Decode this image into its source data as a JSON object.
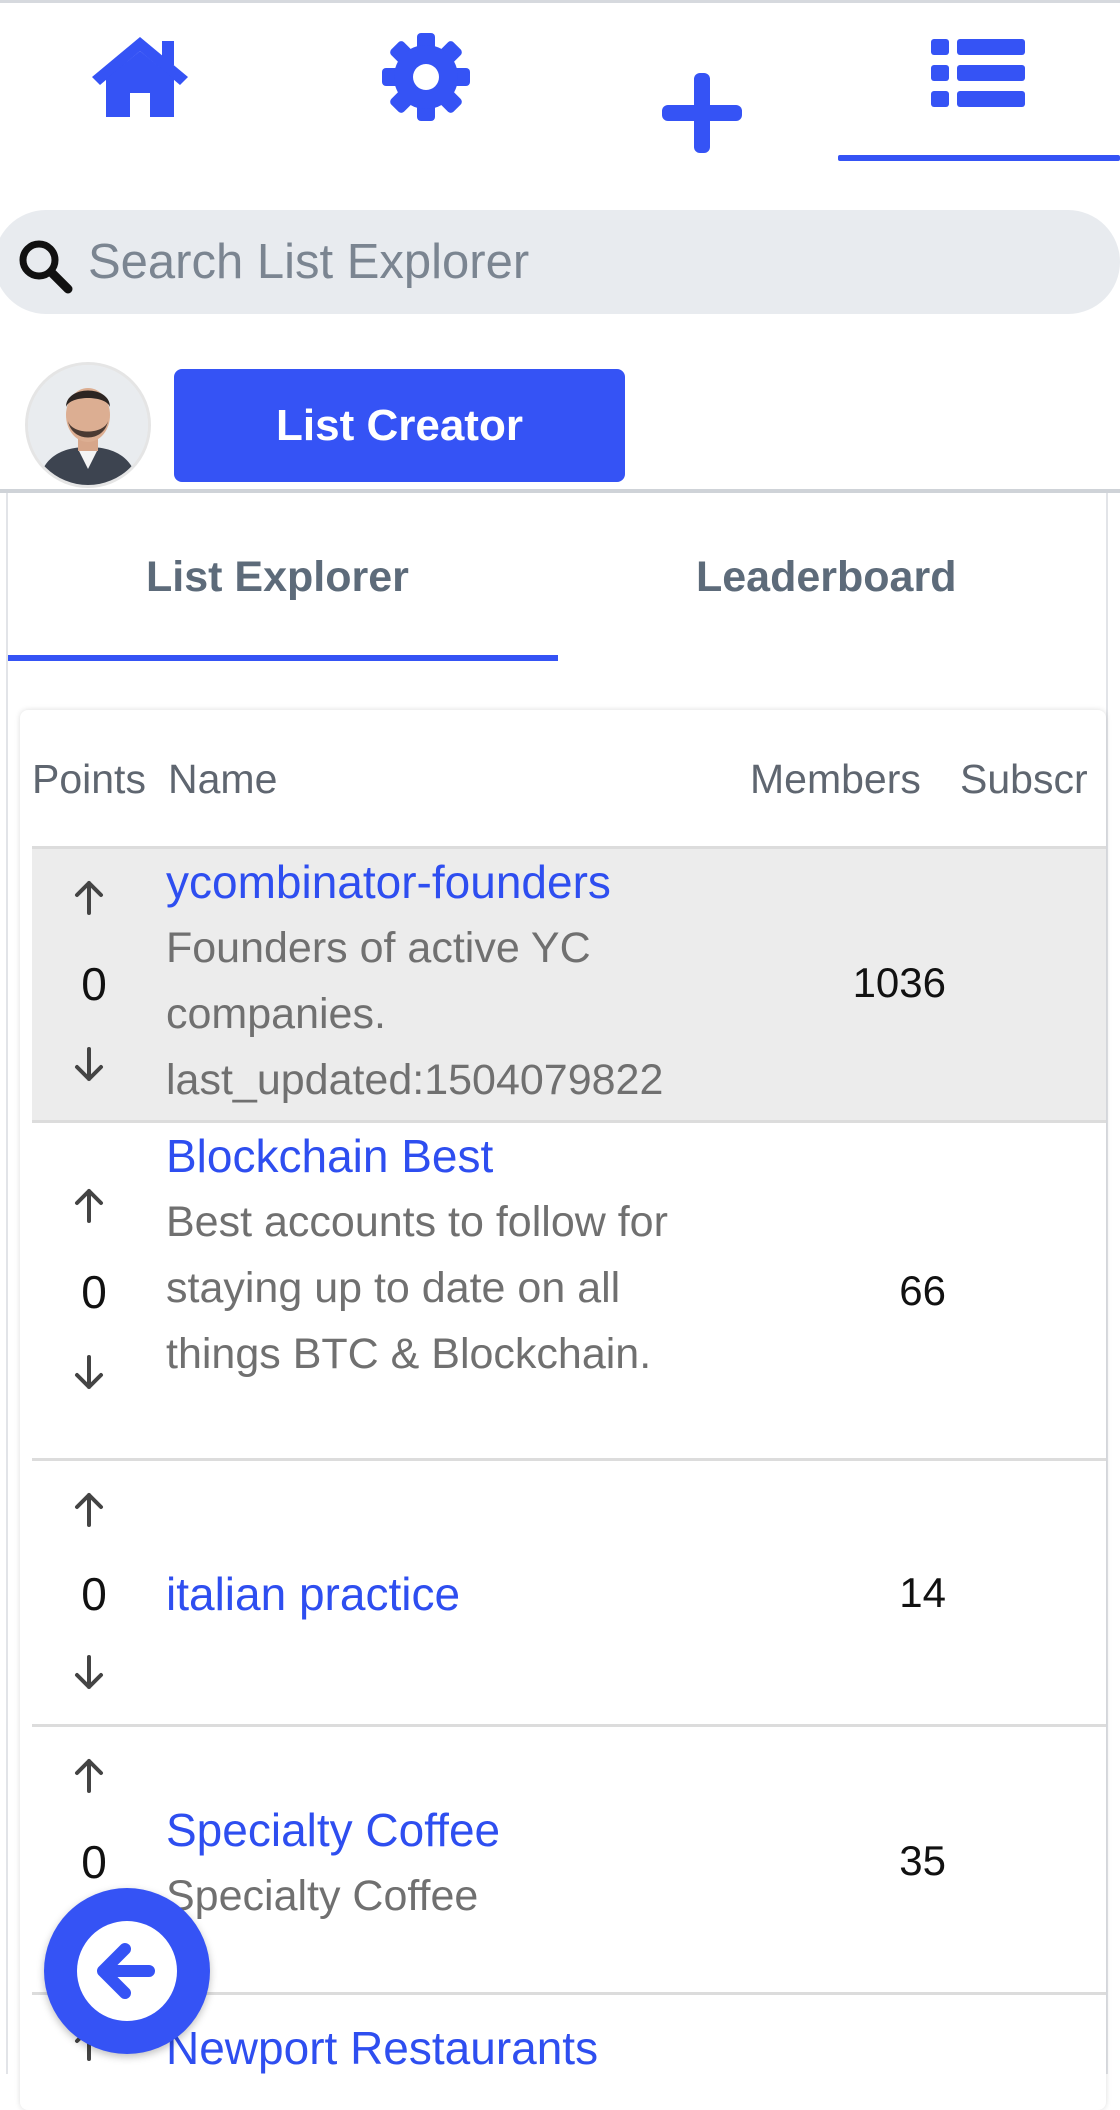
{
  "colors": {
    "accent": "#3553f5",
    "link": "#2e4ef0",
    "search_bg": "#e8ebef",
    "highlight_row": "#ececec"
  },
  "nav": {
    "items": [
      {
        "icon": "home-icon"
      },
      {
        "icon": "gear-icon"
      },
      {
        "icon": "plus-icon"
      },
      {
        "icon": "list-icon",
        "active": true
      }
    ]
  },
  "search": {
    "placeholder": "Search List Explorer",
    "value": ""
  },
  "user": {
    "creator_button_label": "List Creator"
  },
  "tabs": [
    {
      "label": "List Explorer",
      "active": true
    },
    {
      "label": "Leaderboard",
      "active": false
    }
  ],
  "table": {
    "headers": {
      "points": "Points",
      "name": "Name",
      "members": "Members",
      "subscribers": "Subscr"
    },
    "rows": [
      {
        "points": "0",
        "name": "ycombinator-founders",
        "description": "Founders of active YC companies. last_updated:1504079822",
        "members": "1036",
        "highlighted": true
      },
      {
        "points": "0",
        "name": "Blockchain Best",
        "description": "Best accounts to follow for staying up to date on all things BTC & Blockchain.",
        "members": "66"
      },
      {
        "points": "0",
        "name": "italian practice",
        "description": "",
        "members": "14"
      },
      {
        "points": "0",
        "name": "Specialty Coffee",
        "description": "Specialty Coffee",
        "members": "35"
      },
      {
        "points": "",
        "name": "Newport Restaurants",
        "description": "",
        "members": ""
      }
    ]
  },
  "fab": {
    "icon": "arrow-left-circle-icon"
  }
}
